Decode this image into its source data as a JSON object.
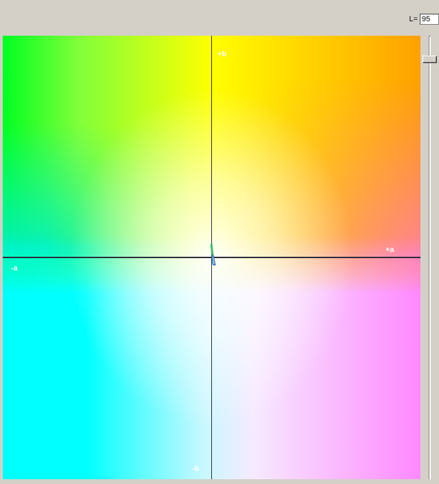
{
  "lightness": {
    "label": "L=",
    "value": "95"
  },
  "plot": {
    "axis_labels": {
      "plus_b": "+b",
      "plus_a": "+a",
      "minus_a": "-a",
      "minus_b": "-b"
    }
  },
  "colors": {
    "window_bg": "#d4d0c8",
    "axis": "#2b2b3a",
    "label": "#ffffff",
    "marker_green": "#3cc46a",
    "marker_blue": "#2f5fbf"
  },
  "icons": {
    "marker": "color-point-marker"
  }
}
